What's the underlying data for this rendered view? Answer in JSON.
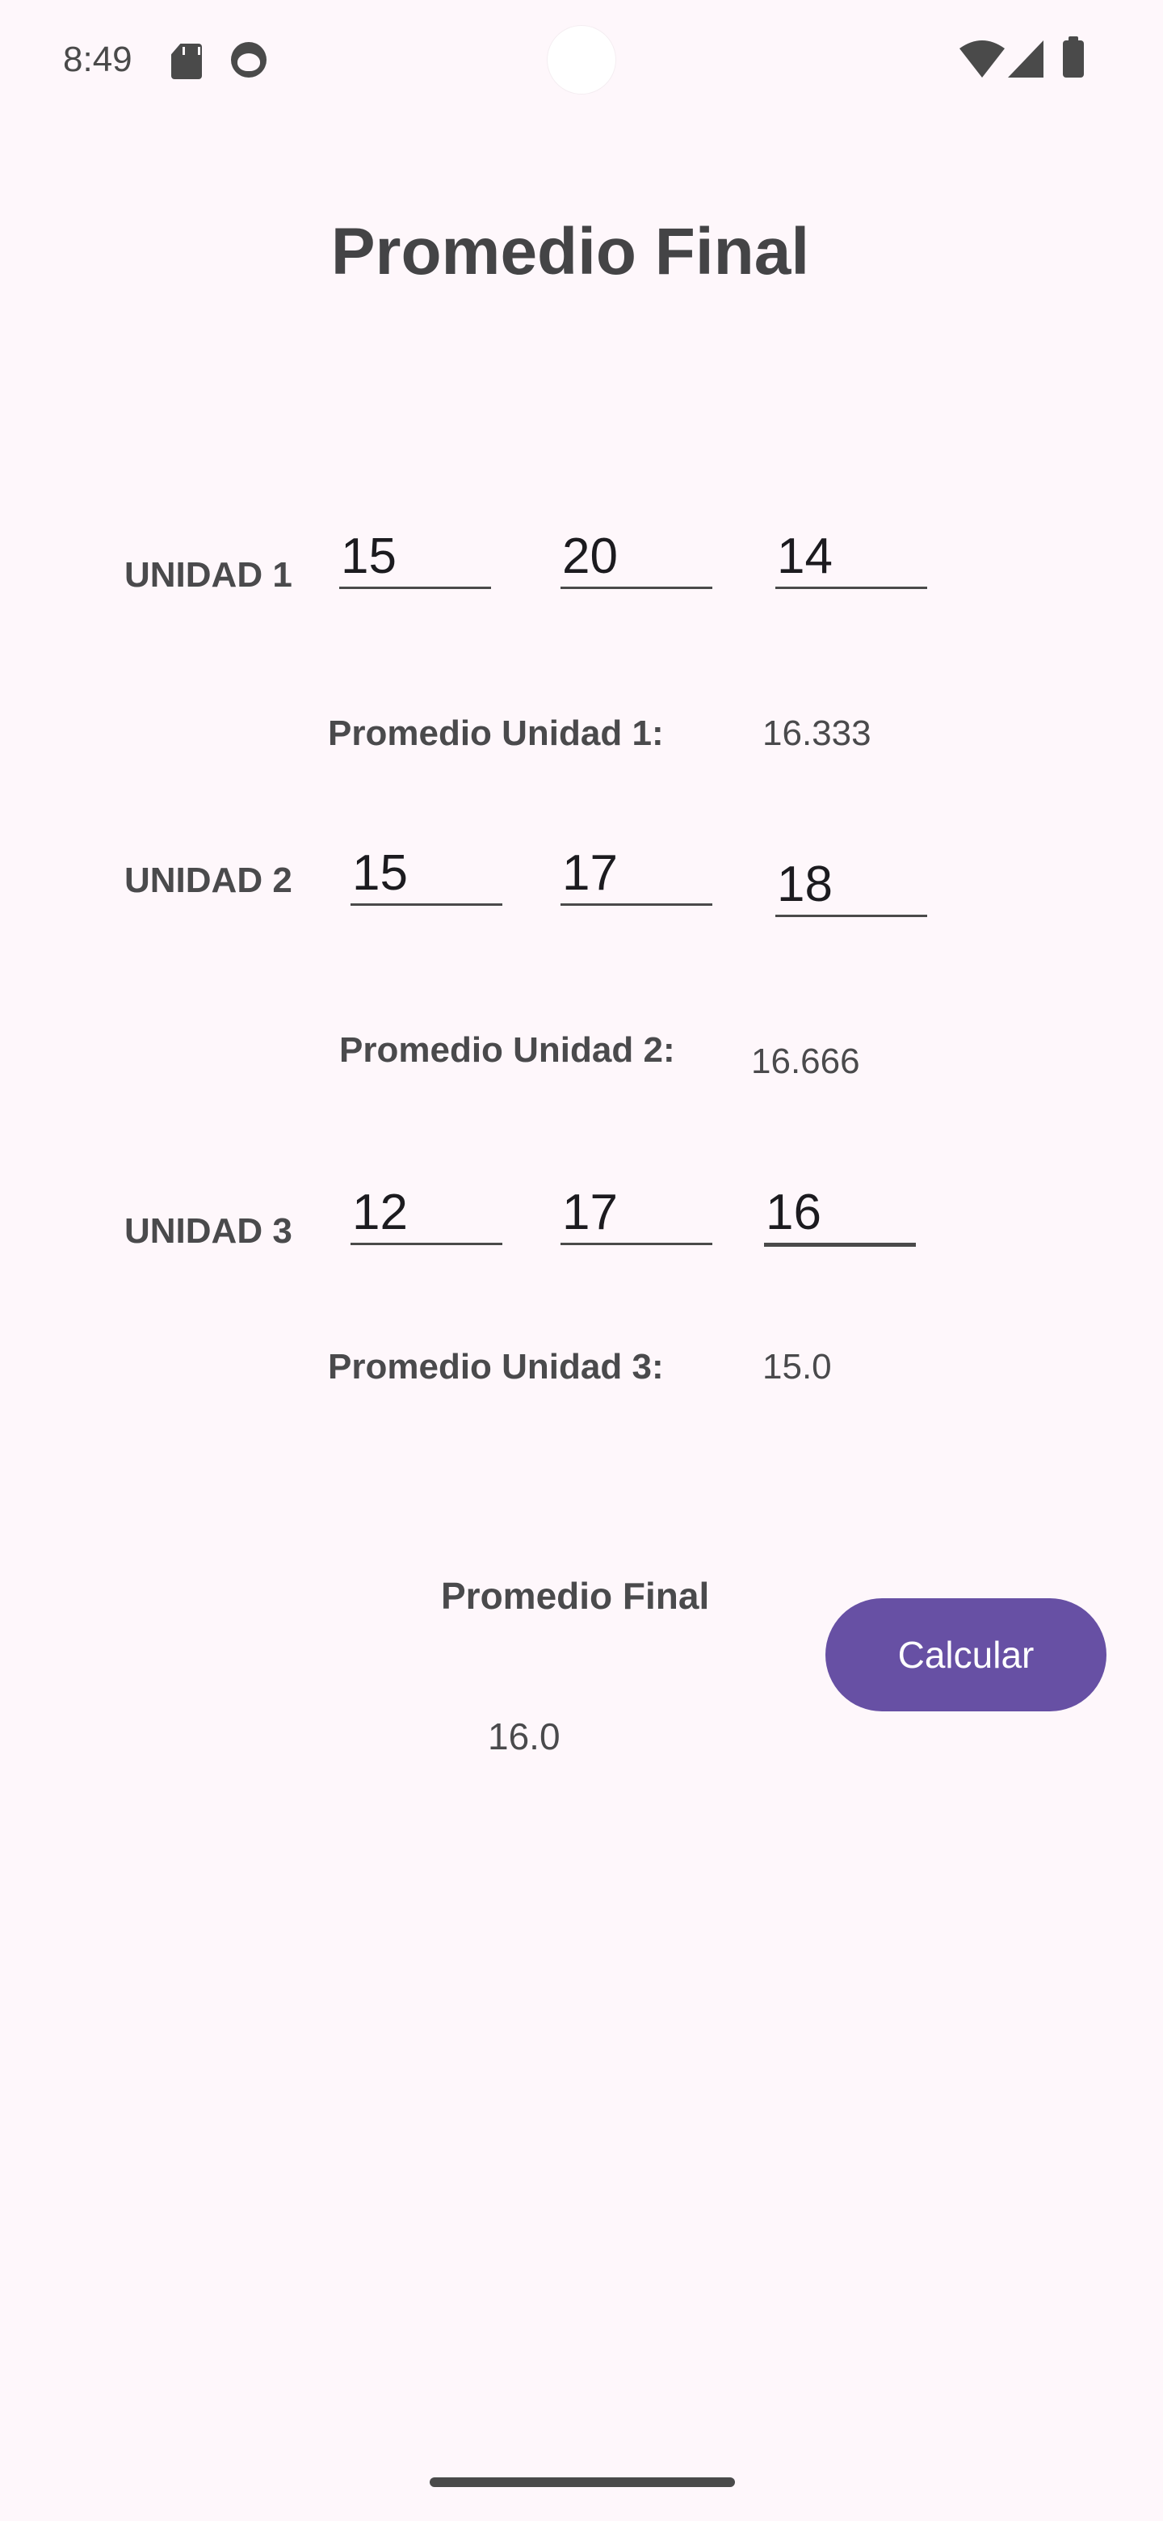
{
  "status_bar": {
    "time": "8:49",
    "icons": [
      "sd-card-icon",
      "face-icon",
      "wifi-icon",
      "signal-icon",
      "battery-icon"
    ]
  },
  "title": "Promedio Final",
  "units": [
    {
      "label": "UNIDAD 1",
      "grades": [
        "15",
        "20",
        "14"
      ],
      "average_label": "Promedio Unidad 1:",
      "average_value": "16.333"
    },
    {
      "label": "UNIDAD 2",
      "grades": [
        "15",
        "17",
        "18"
      ],
      "average_label": "Promedio Unidad 2:",
      "average_value": "16.666"
    },
    {
      "label": "UNIDAD 3",
      "grades": [
        "12",
        "17",
        "16"
      ],
      "average_label": "Promedio Unidad 3:",
      "average_value": "15.0"
    }
  ],
  "final": {
    "label": "Promedio Final",
    "value": "16.0"
  },
  "button": {
    "label": "Calcular"
  },
  "colors": {
    "background": "#FEF7FB",
    "accent": "#6750A4",
    "text": "#4A4A4C"
  }
}
